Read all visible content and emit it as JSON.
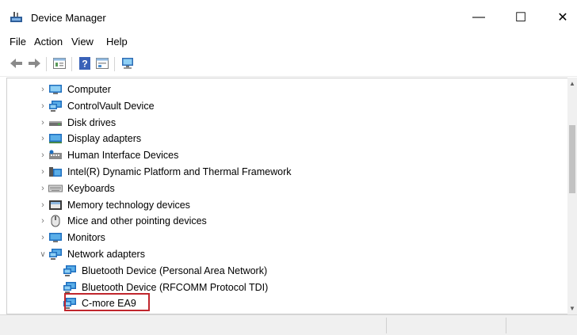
{
  "window": {
    "title": "Device Manager",
    "controls": {
      "minimize": "—",
      "maximize": "☐",
      "close": "✕"
    }
  },
  "menu": [
    "File",
    "Action",
    "View",
    "Help"
  ],
  "toolbar": [
    "back-icon",
    "forward-icon",
    "properties-icon",
    "help-icon",
    "update-driver-icon",
    "scan-hardware-icon"
  ],
  "tree": {
    "categories": [
      {
        "label": "Computer",
        "icon": "computer-icon",
        "expanded": false
      },
      {
        "label": "ControlVault Device",
        "icon": "network-device-icon",
        "expanded": false
      },
      {
        "label": "Disk drives",
        "icon": "disk-drive-icon",
        "expanded": false
      },
      {
        "label": "Display adapters",
        "icon": "display-adapter-icon",
        "expanded": false
      },
      {
        "label": "Human Interface Devices",
        "icon": "hid-icon",
        "expanded": false
      },
      {
        "label": "Intel(R) Dynamic Platform and Thermal Framework",
        "icon": "intel-folder-icon",
        "expanded": false
      },
      {
        "label": "Keyboards",
        "icon": "keyboard-icon",
        "expanded": false
      },
      {
        "label": "Memory technology devices",
        "icon": "memory-device-icon",
        "expanded": false
      },
      {
        "label": "Mice and other pointing devices",
        "icon": "mouse-icon",
        "expanded": false
      },
      {
        "label": "Monitors",
        "icon": "monitor-icon",
        "expanded": false
      },
      {
        "label": "Network adapters",
        "icon": "network-adapter-icon",
        "expanded": true
      }
    ],
    "network_children": [
      {
        "label": "Bluetooth Device (Personal Area Network)",
        "icon": "network-adapter-icon"
      },
      {
        "label": "Bluetooth Device (RFCOMM Protocol TDI)",
        "icon": "network-adapter-icon"
      },
      {
        "label": "C-more EA9",
        "icon": "network-adapter-icon",
        "highlighted": true
      }
    ]
  },
  "colors": {
    "highlight_border": "#c0262d",
    "icon_blue": "#1f6fbf",
    "icon_light_blue": "#5aaee8"
  }
}
